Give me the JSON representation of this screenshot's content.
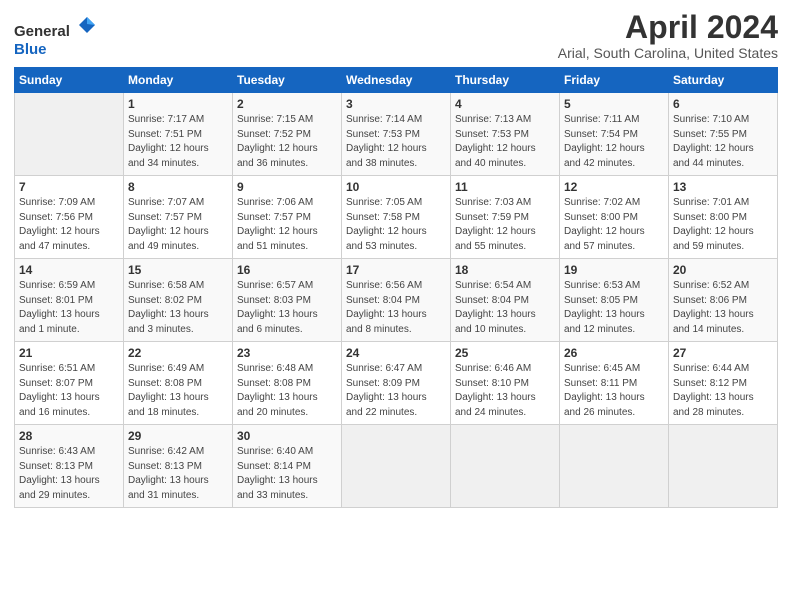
{
  "logo": {
    "general": "General",
    "blue": "Blue"
  },
  "title": "April 2024",
  "subtitle": "Arial, South Carolina, United States",
  "header": {
    "accent_color": "#1565c0"
  },
  "days_of_week": [
    "Sunday",
    "Monday",
    "Tuesday",
    "Wednesday",
    "Thursday",
    "Friday",
    "Saturday"
  ],
  "weeks": [
    [
      {
        "day": "",
        "info": ""
      },
      {
        "day": "1",
        "info": "Sunrise: 7:17 AM\nSunset: 7:51 PM\nDaylight: 12 hours\nand 34 minutes."
      },
      {
        "day": "2",
        "info": "Sunrise: 7:15 AM\nSunset: 7:52 PM\nDaylight: 12 hours\nand 36 minutes."
      },
      {
        "day": "3",
        "info": "Sunrise: 7:14 AM\nSunset: 7:53 PM\nDaylight: 12 hours\nand 38 minutes."
      },
      {
        "day": "4",
        "info": "Sunrise: 7:13 AM\nSunset: 7:53 PM\nDaylight: 12 hours\nand 40 minutes."
      },
      {
        "day": "5",
        "info": "Sunrise: 7:11 AM\nSunset: 7:54 PM\nDaylight: 12 hours\nand 42 minutes."
      },
      {
        "day": "6",
        "info": "Sunrise: 7:10 AM\nSunset: 7:55 PM\nDaylight: 12 hours\nand 44 minutes."
      }
    ],
    [
      {
        "day": "7",
        "info": "Sunrise: 7:09 AM\nSunset: 7:56 PM\nDaylight: 12 hours\nand 47 minutes."
      },
      {
        "day": "8",
        "info": "Sunrise: 7:07 AM\nSunset: 7:57 PM\nDaylight: 12 hours\nand 49 minutes."
      },
      {
        "day": "9",
        "info": "Sunrise: 7:06 AM\nSunset: 7:57 PM\nDaylight: 12 hours\nand 51 minutes."
      },
      {
        "day": "10",
        "info": "Sunrise: 7:05 AM\nSunset: 7:58 PM\nDaylight: 12 hours\nand 53 minutes."
      },
      {
        "day": "11",
        "info": "Sunrise: 7:03 AM\nSunset: 7:59 PM\nDaylight: 12 hours\nand 55 minutes."
      },
      {
        "day": "12",
        "info": "Sunrise: 7:02 AM\nSunset: 8:00 PM\nDaylight: 12 hours\nand 57 minutes."
      },
      {
        "day": "13",
        "info": "Sunrise: 7:01 AM\nSunset: 8:00 PM\nDaylight: 12 hours\nand 59 minutes."
      }
    ],
    [
      {
        "day": "14",
        "info": "Sunrise: 6:59 AM\nSunset: 8:01 PM\nDaylight: 13 hours\nand 1 minute."
      },
      {
        "day": "15",
        "info": "Sunrise: 6:58 AM\nSunset: 8:02 PM\nDaylight: 13 hours\nand 3 minutes."
      },
      {
        "day": "16",
        "info": "Sunrise: 6:57 AM\nSunset: 8:03 PM\nDaylight: 13 hours\nand 6 minutes."
      },
      {
        "day": "17",
        "info": "Sunrise: 6:56 AM\nSunset: 8:04 PM\nDaylight: 13 hours\nand 8 minutes."
      },
      {
        "day": "18",
        "info": "Sunrise: 6:54 AM\nSunset: 8:04 PM\nDaylight: 13 hours\nand 10 minutes."
      },
      {
        "day": "19",
        "info": "Sunrise: 6:53 AM\nSunset: 8:05 PM\nDaylight: 13 hours\nand 12 minutes."
      },
      {
        "day": "20",
        "info": "Sunrise: 6:52 AM\nSunset: 8:06 PM\nDaylight: 13 hours\nand 14 minutes."
      }
    ],
    [
      {
        "day": "21",
        "info": "Sunrise: 6:51 AM\nSunset: 8:07 PM\nDaylight: 13 hours\nand 16 minutes."
      },
      {
        "day": "22",
        "info": "Sunrise: 6:49 AM\nSunset: 8:08 PM\nDaylight: 13 hours\nand 18 minutes."
      },
      {
        "day": "23",
        "info": "Sunrise: 6:48 AM\nSunset: 8:08 PM\nDaylight: 13 hours\nand 20 minutes."
      },
      {
        "day": "24",
        "info": "Sunrise: 6:47 AM\nSunset: 8:09 PM\nDaylight: 13 hours\nand 22 minutes."
      },
      {
        "day": "25",
        "info": "Sunrise: 6:46 AM\nSunset: 8:10 PM\nDaylight: 13 hours\nand 24 minutes."
      },
      {
        "day": "26",
        "info": "Sunrise: 6:45 AM\nSunset: 8:11 PM\nDaylight: 13 hours\nand 26 minutes."
      },
      {
        "day": "27",
        "info": "Sunrise: 6:44 AM\nSunset: 8:12 PM\nDaylight: 13 hours\nand 28 minutes."
      }
    ],
    [
      {
        "day": "28",
        "info": "Sunrise: 6:43 AM\nSunset: 8:13 PM\nDaylight: 13 hours\nand 29 minutes."
      },
      {
        "day": "29",
        "info": "Sunrise: 6:42 AM\nSunset: 8:13 PM\nDaylight: 13 hours\nand 31 minutes."
      },
      {
        "day": "30",
        "info": "Sunrise: 6:40 AM\nSunset: 8:14 PM\nDaylight: 13 hours\nand 33 minutes."
      },
      {
        "day": "",
        "info": ""
      },
      {
        "day": "",
        "info": ""
      },
      {
        "day": "",
        "info": ""
      },
      {
        "day": "",
        "info": ""
      }
    ]
  ]
}
